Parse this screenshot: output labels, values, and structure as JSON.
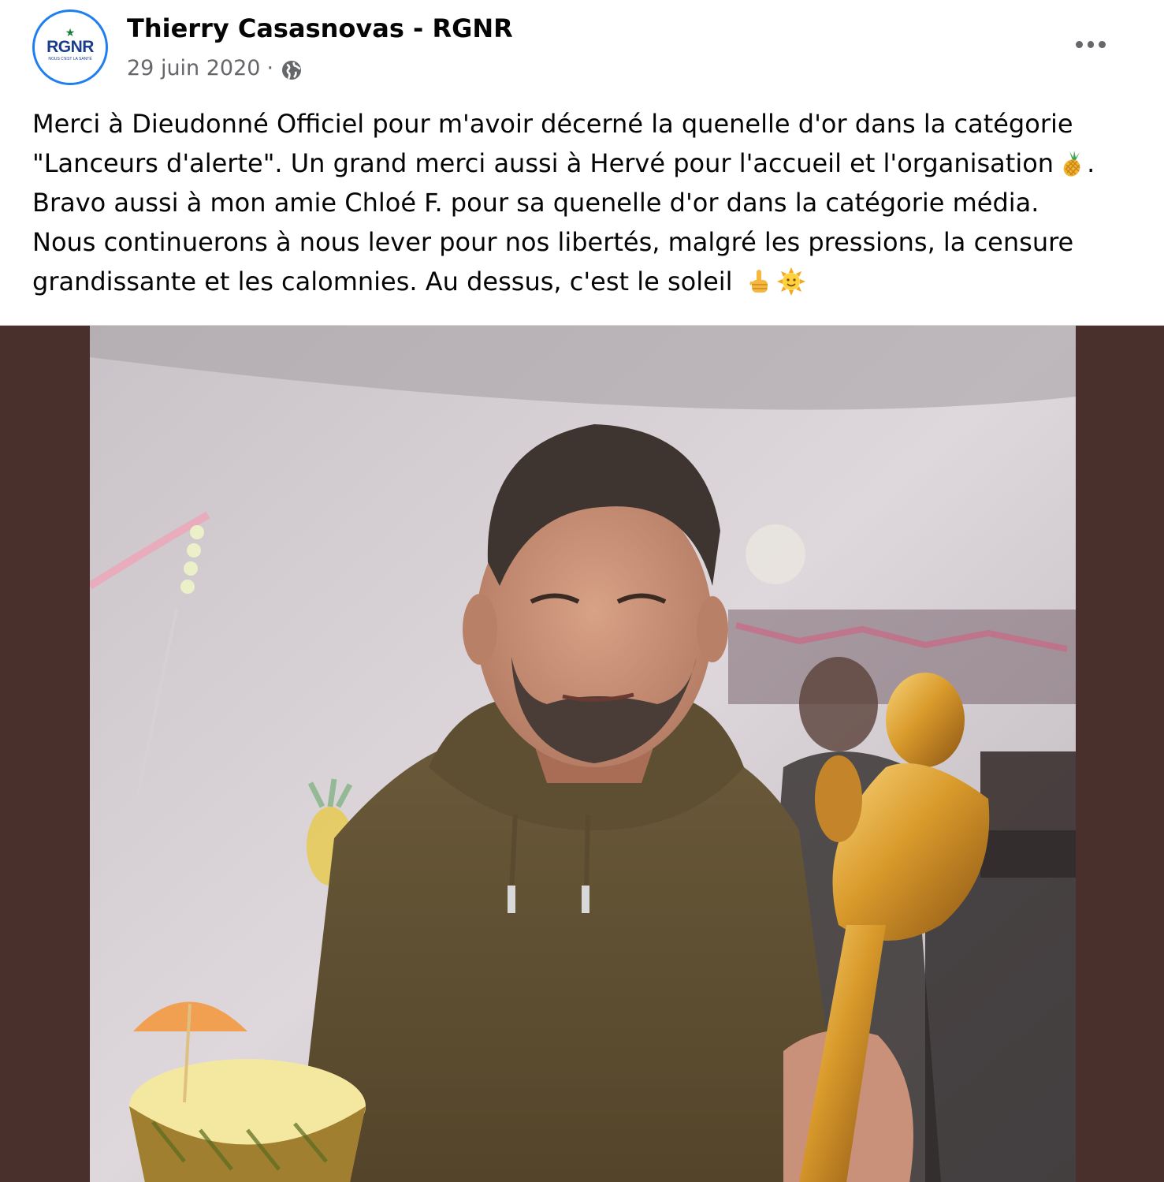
{
  "post": {
    "author": {
      "name": "Thierry Casasnovas - RGNR",
      "avatar_text": "RGNR",
      "avatar_subtext": "NOUS C'EST LA SANTÉ",
      "avatar_star": "★"
    },
    "meta": {
      "date": "29 juin 2020",
      "separator": "·",
      "audience_icon": "globe-icon"
    },
    "more_icon": "more-options-icon",
    "text_lines": [
      "Merci à Dieudonné Officiel pour m'avoir décerné la quenelle d'or dans la catégorie",
      "\"Lanceurs d'alerte\". Un grand merci aussi à Hervé pour l'accueil et l'organisation",
      ".",
      "Bravo aussi à mon amie Chloé F. pour sa quenelle d'or dans la catégorie média.",
      "Nous continuerons à nous lever pour nos libertés, malgré les pressions, la censure",
      "grandissante et les calomnies. Au dessus, c'est le soleil"
    ],
    "emojis": [
      "pineapple-icon",
      "pointing-up-icon",
      "sun-face-icon"
    ],
    "photo_icon": "post-photo",
    "colors": {
      "text": "#050505",
      "secondary": "#65676b",
      "avatar_ring": "#1f7ef0",
      "photo_letterbox": "#4a302c"
    }
  }
}
